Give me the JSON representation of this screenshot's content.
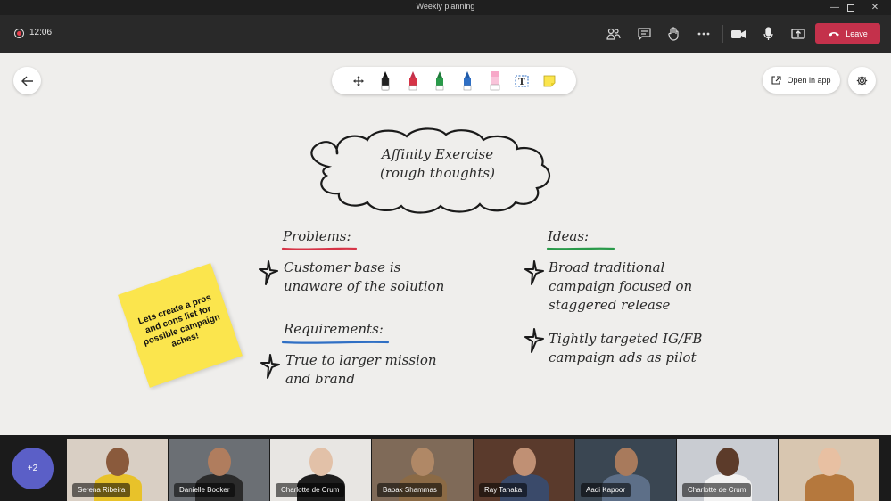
{
  "window": {
    "title": "Weekly planning"
  },
  "meeting": {
    "timer": "12:06",
    "leave_label": "Leave",
    "toolbar_icons": [
      "people-icon",
      "chat-icon",
      "raise-hand-icon",
      "more-icon",
      "camera-icon",
      "mic-icon",
      "share-icon"
    ]
  },
  "whiteboard": {
    "open_in_app_label": "Open in app",
    "tools": [
      "move-icon",
      "black-pen-icon",
      "red-pen-icon",
      "green-pen-icon",
      "blue-pen-icon",
      "highlighter-icon",
      "text-tool-icon",
      "sticky-note-icon"
    ],
    "cloud": {
      "line1": "Affinity Exercise",
      "line2": "(rough thoughts)"
    },
    "problems": {
      "heading": "Problems:",
      "underline_color": "#d63447",
      "items": [
        {
          "line1": "Customer base is",
          "line2": "unaware of the solution"
        }
      ]
    },
    "requirements": {
      "heading": "Requirements:",
      "underline_color": "#2f6fc4",
      "items": [
        {
          "line1": "True to larger mission",
          "line2": "and brand"
        }
      ]
    },
    "ideas": {
      "heading": "Ideas:",
      "underline_color": "#2a9a4a",
      "items": [
        {
          "line1": "Broad traditional",
          "line2": "campaign focused on",
          "line3": "staggered release"
        },
        {
          "line1": "Tightly targeted IG/FB",
          "line2": "campaign ads as pilot"
        }
      ]
    },
    "sticky_note": "Lets create a pros and cons list for possible campaign aches!"
  },
  "participants": {
    "overflow_label": "+2",
    "tiles": [
      {
        "name": "Serena Ribeira",
        "bg": "#d9cfc4",
        "skin": "#8a5a3c",
        "shirt": "#e8c22a"
      },
      {
        "name": "Danielle Booker",
        "bg": "#6b6f74",
        "skin": "#b07d5e",
        "shirt": "#2b2b2b"
      },
      {
        "name": "Charlotte de Crum",
        "bg": "#e8e6e3",
        "skin": "#e2c1a8",
        "shirt": "#1e1e1e"
      },
      {
        "name": "Babak Shammas",
        "bg": "#7f6a58",
        "skin": "#b08866",
        "shirt": "#8b6a45"
      },
      {
        "name": "Ray Tanaka",
        "bg": "#5a3a2c",
        "skin": "#c09074",
        "shirt": "#3a4a6a"
      },
      {
        "name": "Aadi Kapoor",
        "bg": "#3a4652",
        "skin": "#a87a5c",
        "shirt": "#5d6f88"
      },
      {
        "name": "Charlotte de Crum",
        "bg": "#c9ccd2",
        "skin": "#5c3b2a",
        "shirt": "#f2f2f2"
      },
      {
        "name": "",
        "bg": "#d8c6b0",
        "skin": "#e8c0a2",
        "shirt": "#b5783d"
      }
    ]
  }
}
